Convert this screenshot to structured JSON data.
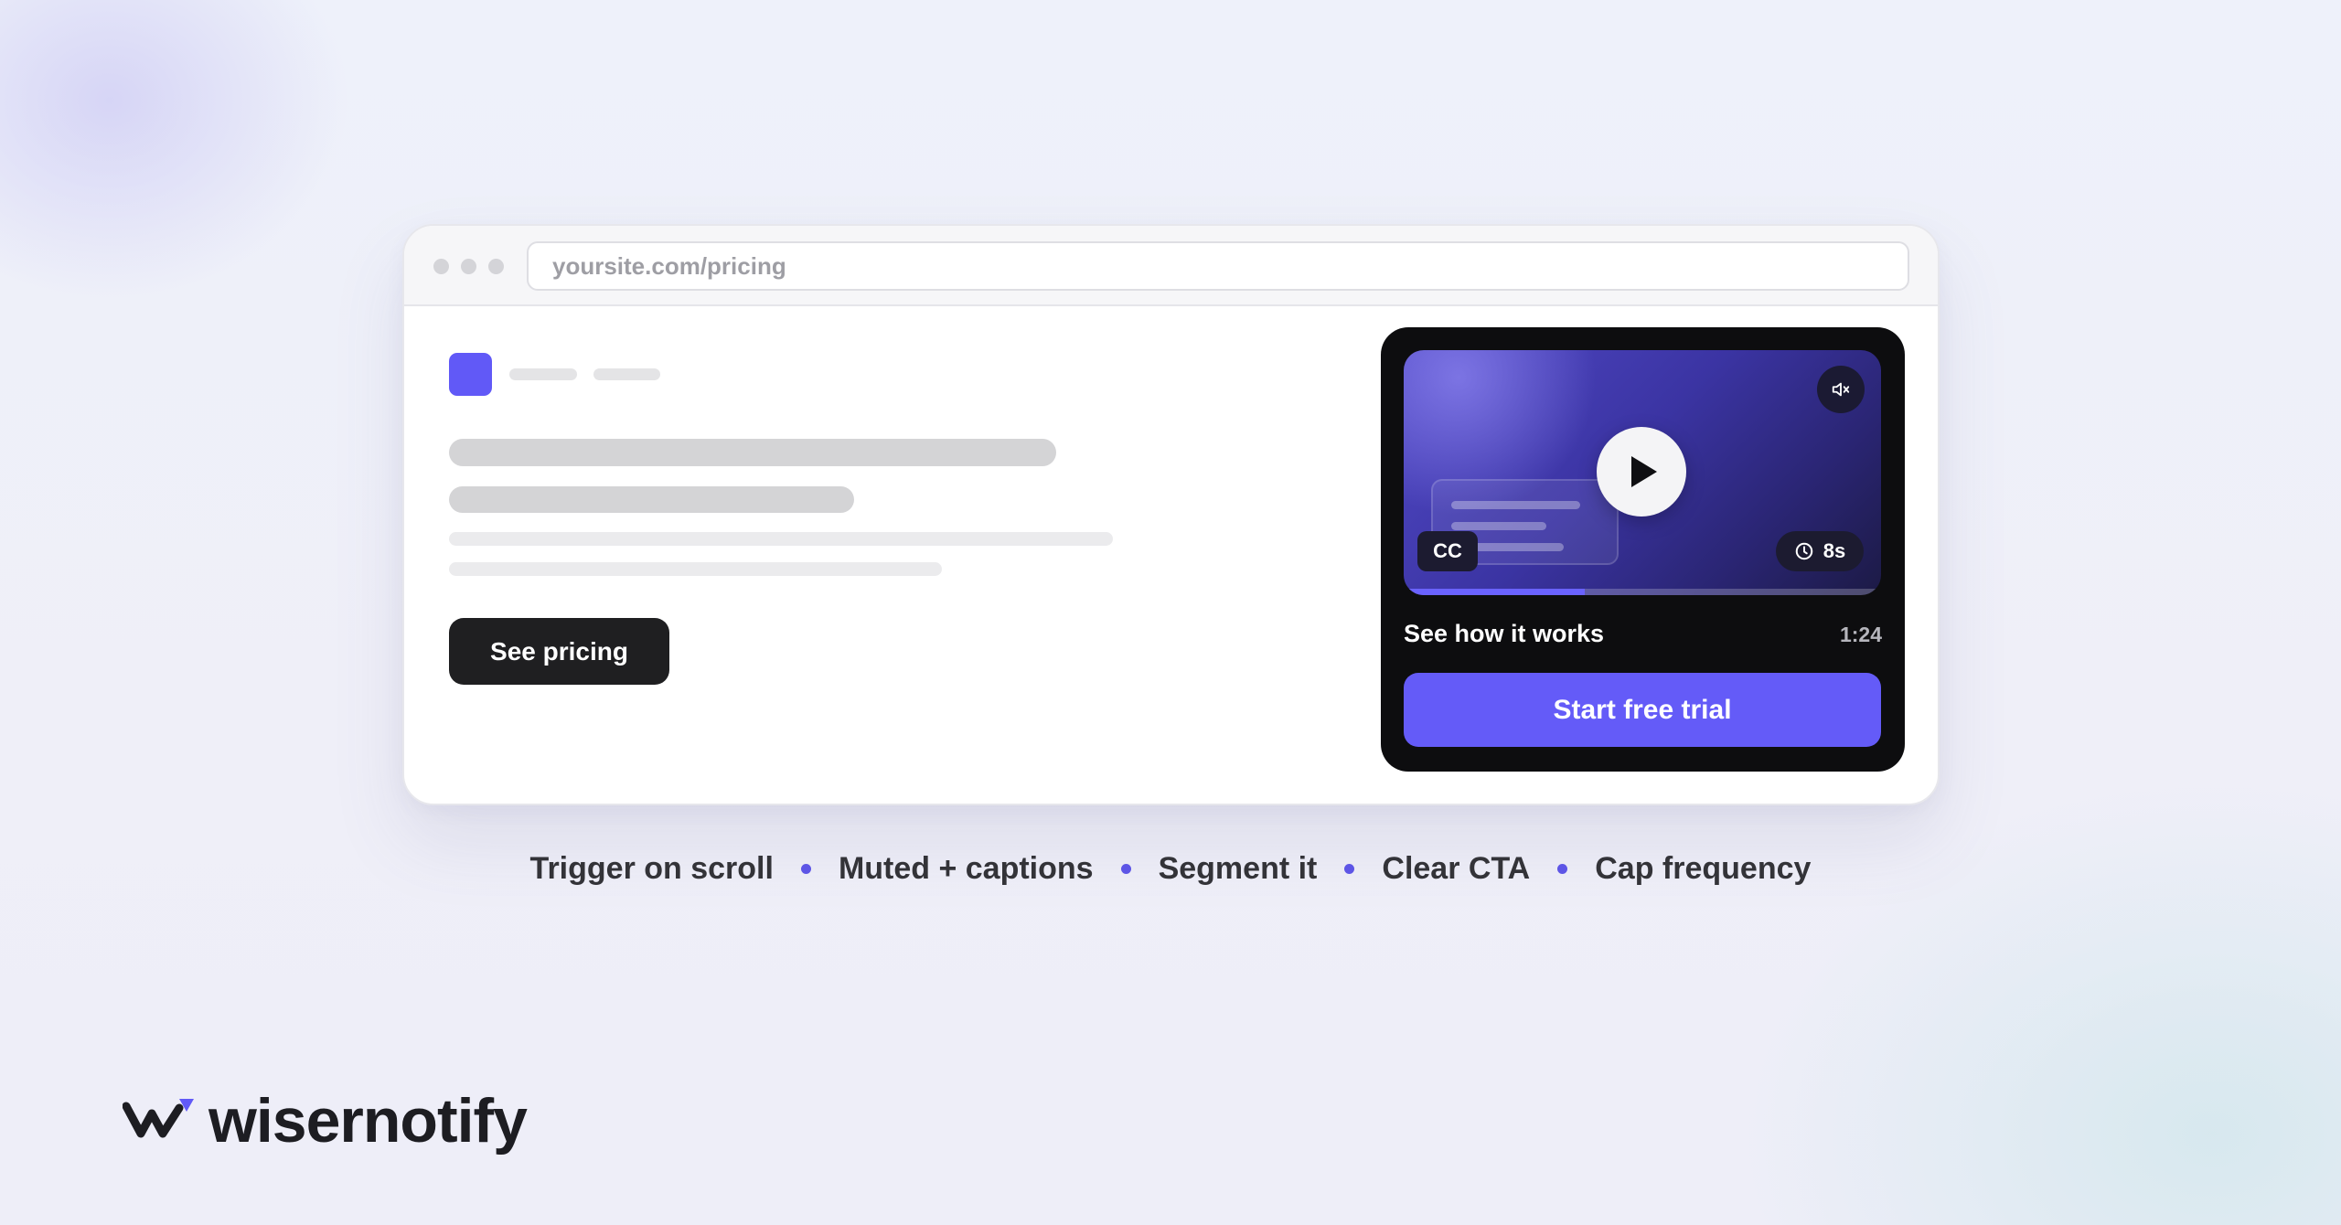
{
  "browser": {
    "url": "yoursite.com/pricing",
    "page": {
      "pricing_button_label": "See pricing"
    }
  },
  "widget": {
    "video": {
      "captions_badge": "CC",
      "countdown": "8s",
      "progress_fraction": 0.38,
      "play_icon": "play-icon",
      "mute_icon": "muted-speaker-icon"
    },
    "title": "See how it works",
    "duration": "1:24",
    "cta_label": "Start free trial"
  },
  "features": [
    "Trigger on scroll",
    "Muted + captions",
    "Segment it",
    "Clear CTA",
    "Cap frequency"
  ],
  "brand": {
    "name": "wisernotify"
  },
  "colors": {
    "accent": "#645bf8",
    "dark_button": "#1f1f21",
    "widget_bg": "#0d0d0f",
    "separator_dot": "#5d55e6"
  }
}
